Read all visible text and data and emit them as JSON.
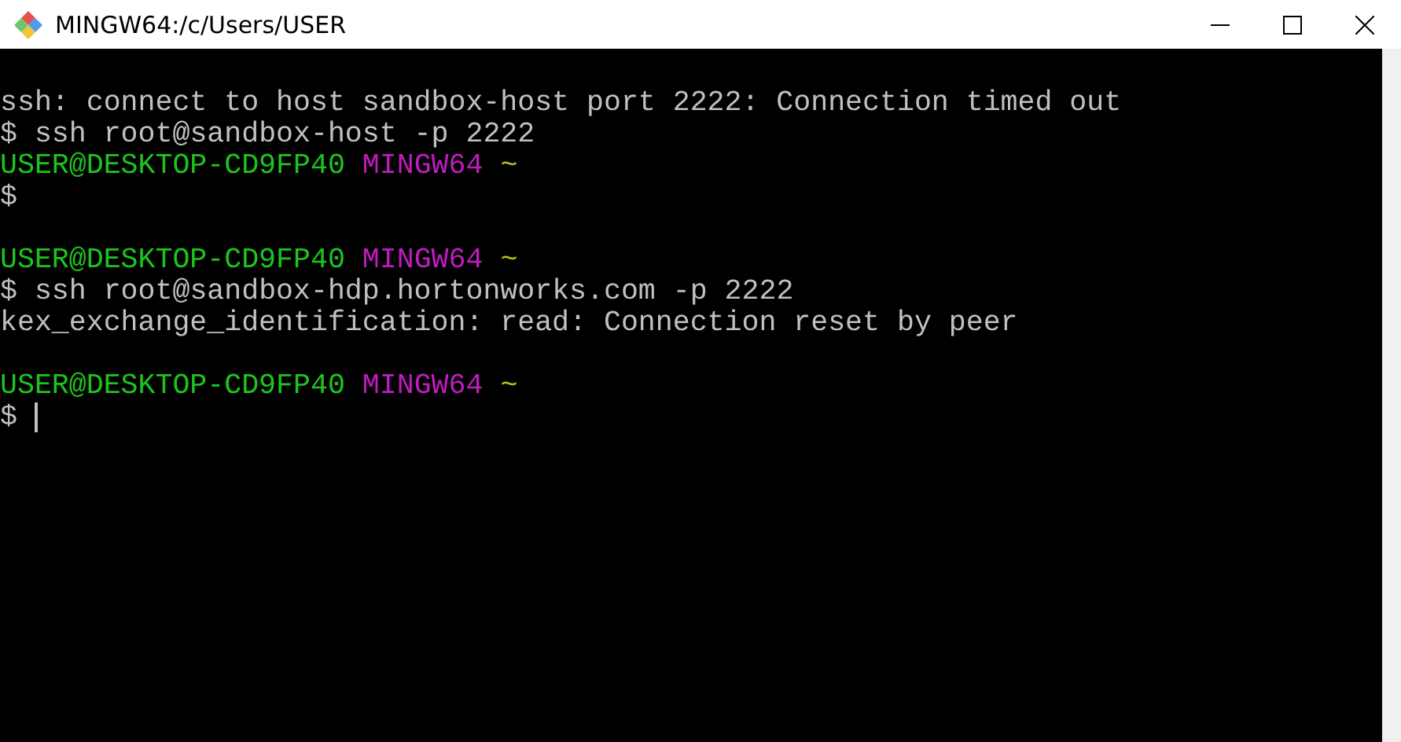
{
  "window": {
    "title": "MINGW64:/c/Users/USER"
  },
  "terminal": {
    "lines": [
      {
        "kind": "output",
        "text": "ssh: connect to host sandbox-host port 2222: Connection timed out"
      },
      {
        "kind": "command",
        "sign": "$",
        "text": "ssh root@sandbox-host -p 2222"
      },
      {
        "kind": "prompt",
        "user_host": "USER@DESKTOP-CD9FP40",
        "shell": "MINGW64",
        "path": "~"
      },
      {
        "kind": "command",
        "sign": "$",
        "cursor": false
      },
      {
        "kind": "blank"
      },
      {
        "kind": "prompt",
        "user_host": "USER@DESKTOP-CD9FP40",
        "shell": "MINGW64",
        "path": "~"
      },
      {
        "kind": "command",
        "sign": "$",
        "text": "ssh root@sandbox-hdp.hortonworks.com -p 2222"
      },
      {
        "kind": "output",
        "text": "kex_exchange_identification: read: Connection reset by peer"
      },
      {
        "kind": "blank"
      },
      {
        "kind": "prompt",
        "user_host": "USER@DESKTOP-CD9FP40",
        "shell": "MINGW64",
        "path": "~"
      },
      {
        "kind": "command",
        "sign": "$",
        "cursor": true
      }
    ]
  }
}
